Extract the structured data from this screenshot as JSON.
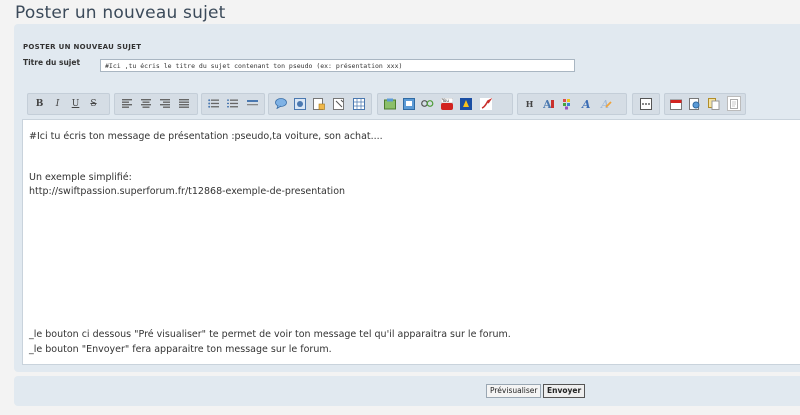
{
  "page": {
    "title": "Poster un nouveau sujet"
  },
  "form": {
    "heading": "POSTER UN NOUVEAU SUJET",
    "subject_label": "Titre du sujet",
    "subject_value": "#Ici ,tu écris le titre du sujet contenant ton pseudo (ex: présentation xxx)"
  },
  "toolbar": {
    "buttons": [
      {
        "name": "bold-icon",
        "glyph": "B"
      },
      {
        "name": "italic-icon",
        "glyph": "I"
      },
      {
        "name": "underline-icon",
        "glyph": "U"
      },
      {
        "name": "strikethrough-icon",
        "glyph": "S"
      },
      {
        "name": "align-left-icon"
      },
      {
        "name": "align-center-icon"
      },
      {
        "name": "align-right-icon"
      },
      {
        "name": "align-justify-icon"
      },
      {
        "name": "bullet-list-icon"
      },
      {
        "name": "numbered-list-icon"
      },
      {
        "name": "horizontal-rule-icon"
      },
      {
        "name": "speech-bubble-icon"
      },
      {
        "name": "spoiler-icon"
      },
      {
        "name": "hide-icon"
      },
      {
        "name": "code-icon"
      },
      {
        "name": "table-icon"
      },
      {
        "name": "insert-image-icon"
      },
      {
        "name": "host-image-icon"
      },
      {
        "name": "link-icon"
      },
      {
        "name": "youtube-icon"
      },
      {
        "name": "dailymotion-icon"
      },
      {
        "name": "flash-icon"
      },
      {
        "name": "heading-icon",
        "glyph": "H"
      },
      {
        "name": "font-size-icon"
      },
      {
        "name": "color-icon"
      },
      {
        "name": "font-icon"
      },
      {
        "name": "clear-format-icon"
      },
      {
        "name": "other-icon"
      },
      {
        "name": "date-icon"
      },
      {
        "name": "preview-zoom-icon"
      },
      {
        "name": "copy-icon"
      },
      {
        "name": "paste-icon"
      }
    ]
  },
  "editor": {
    "lines": [
      "#Ici tu écris ton message de présentation :pseudo,ta voiture, son achat....",
      "Un exemple simplifié:",
      "http://swiftpassion.superforum.fr/t12868-exemple-de-presentation",
      "_le bouton ci dessous \"Pré visualiser\" te permet de voir ton message tel qu'il apparaitra sur le forum.",
      "_le bouton \"Envoyer\" fera apparaitre ton message sur le forum."
    ]
  },
  "footer": {
    "preview_label": "Prévisualiser",
    "send_label": "Envoyer"
  },
  "colors": {
    "panel_bg": "#e1e9f0",
    "title": "#3b4a5a"
  }
}
